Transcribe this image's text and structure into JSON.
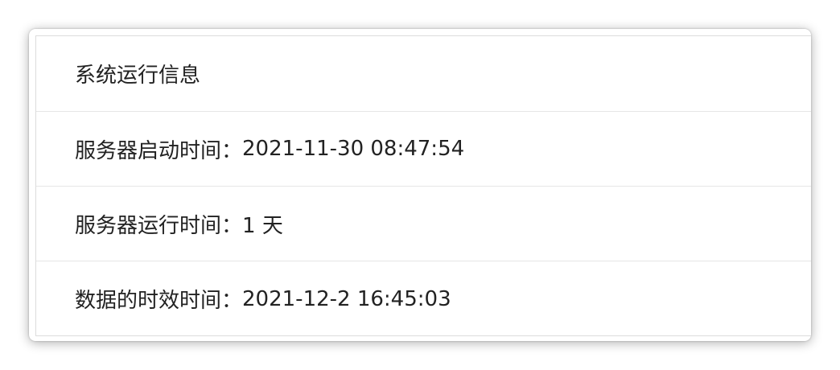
{
  "panel": {
    "title": "系统运行信息",
    "rows": [
      {
        "label": "服务器启动时间：",
        "value": "2021-11-30 08:47:54"
      },
      {
        "label": "服务器运行时间：",
        "value": "1 天"
      },
      {
        "label": "数据的时效时间：",
        "value": "2021-12-2 16:45:03"
      }
    ]
  }
}
